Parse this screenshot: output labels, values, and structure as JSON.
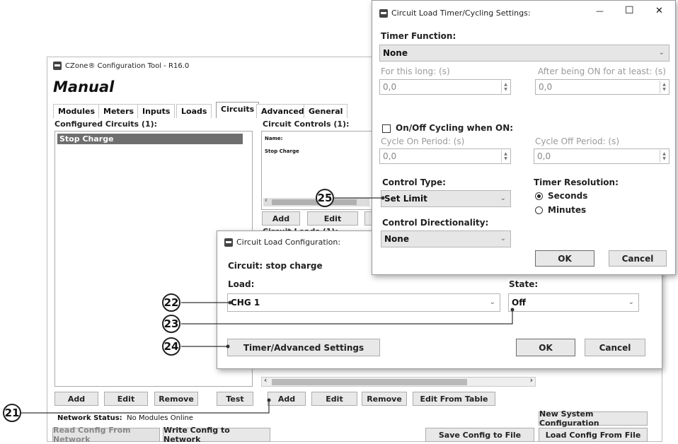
{
  "main_window": {
    "title": "CZone® Configuration Tool - R16.0",
    "mode": "Manual",
    "tabs": [
      "Modules",
      "Meters",
      "Inputs",
      "Loads",
      "Circuits",
      "Advanced",
      "General"
    ],
    "active_tab": "Circuits",
    "configured_circuits_label": "Configured Circuits (1):",
    "configured_circuits": [
      "Stop Charge"
    ],
    "circuit_controls_label": "Circuit Controls (1):",
    "circuit_controls_header": "Name:",
    "circuit_controls_items": [
      "Stop Charge"
    ],
    "circuit_loads_label": "Circuit Loads (1):",
    "left_buttons": [
      "Add",
      "Edit",
      "Remove",
      "Test"
    ],
    "controls_buttons": [
      "Add",
      "Edit"
    ],
    "loads_buttons": [
      "Add",
      "Edit",
      "Remove",
      "Edit From Table"
    ],
    "network_status_label": "Network Status:",
    "network_status_value": "No Modules Online",
    "new_system_button": "New System Configuration",
    "read_config_button": "Read Config From Network",
    "write_config_button": "Write Config to Network",
    "save_config_button": "Save Config to File",
    "load_config_button": "Load Config From File"
  },
  "load_dialog": {
    "title": "Circuit Load Configuration:",
    "circuit_label": "Circuit: stop charge",
    "load_label": "Load:",
    "load_value": "CHG 1",
    "state_label": "State:",
    "state_value": "Off",
    "timer_button": "Timer/Advanced Settings",
    "ok_button": "OK",
    "cancel_button": "Cancel"
  },
  "timer_dialog": {
    "title": "Circuit Load Timer/Cycling Settings:",
    "minimize": "—",
    "maximize": "☐",
    "close": "✕",
    "timer_function_label": "Timer Function:",
    "timer_function_value": "None",
    "for_this_long_label": "For this long: (s)",
    "for_this_long_value": "0,0",
    "after_on_label": "After being ON for at least: (s)",
    "after_on_value": "0,0",
    "cycling_label": "On/Off Cycling when ON:",
    "cycle_on_label": "Cycle On Period: (s)",
    "cycle_on_value": "0,0",
    "cycle_off_label": "Cycle Off Period: (s)",
    "cycle_off_value": "0,0",
    "control_type_label": "Control Type:",
    "control_type_value": "Set Limit",
    "timer_resolution_label": "Timer Resolution:",
    "seconds_label": "Seconds",
    "minutes_label": "Minutes",
    "control_directionality_label": "Control Directionality:",
    "control_directionality_value": "None",
    "ok_button": "OK",
    "cancel_button": "Cancel"
  },
  "callouts": [
    "21",
    "22",
    "23",
    "24",
    "25"
  ],
  "icons": {
    "dropdown": "chevron-down-icon",
    "spinner": "spinner-icon",
    "app": "app-icon"
  }
}
